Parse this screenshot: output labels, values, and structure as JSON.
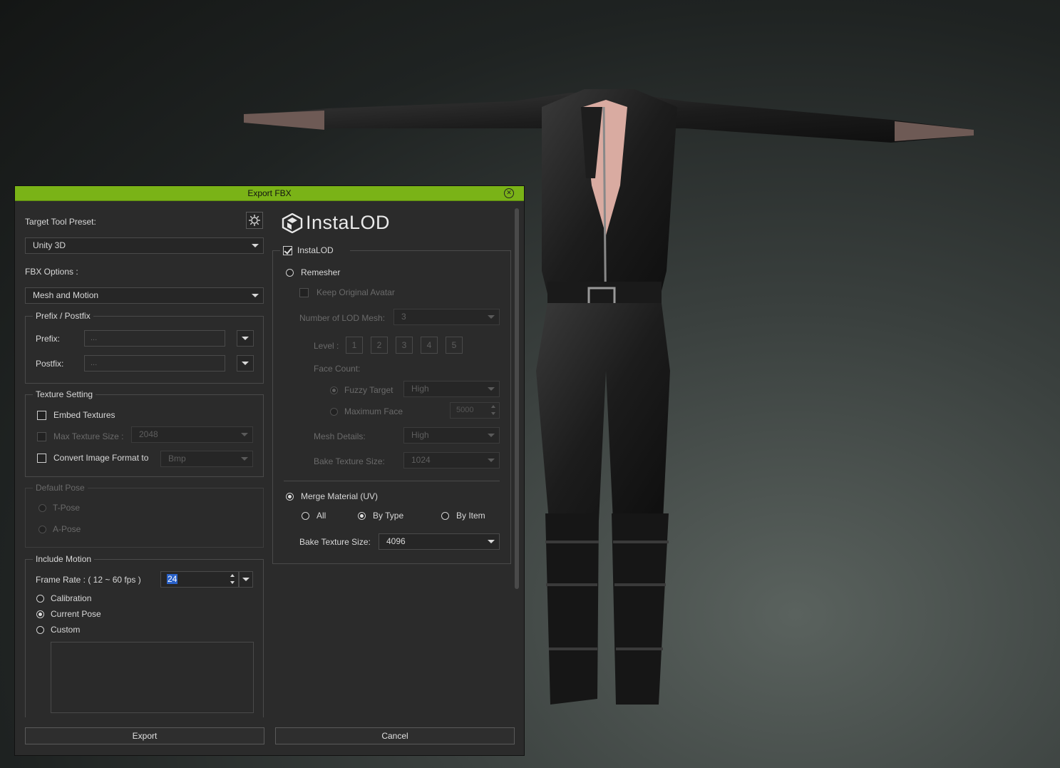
{
  "dialog": {
    "title": "Export FBX",
    "close_icon": "close-icon",
    "target_tool_preset_label": "Target Tool Preset:",
    "target_tool_preset_value": "Unity 3D",
    "fbx_options_label": "FBX Options :",
    "fbx_options_value": "Mesh and Motion",
    "prefix_postfix": {
      "legend": "Prefix / Postfix",
      "prefix_label": "Prefix:",
      "prefix_value": "...",
      "postfix_label": "Postfix:",
      "postfix_value": "..."
    },
    "texture_setting": {
      "legend": "Texture Setting",
      "embed_textures_label": "Embed Textures",
      "embed_textures_checked": false,
      "max_texture_size_label": "Max Texture Size :",
      "max_texture_size_value": "2048",
      "convert_format_label": "Convert Image Format to",
      "convert_format_value": "Bmp"
    },
    "default_pose": {
      "legend": "Default Pose",
      "t_pose": "T-Pose",
      "a_pose": "A-Pose"
    },
    "include_motion": {
      "legend": "Include Motion",
      "frame_rate_label": "Frame Rate : ( 12 ~ 60 fps )",
      "frame_rate_value": "24",
      "calibration": "Calibration",
      "current_pose": "Current Pose",
      "custom": "Custom",
      "selected": "Current Pose"
    },
    "export_button": "Export",
    "cancel_button": "Cancel"
  },
  "instalod": {
    "logo_text": "InstaLOD",
    "enable_label": "InstaLOD",
    "enable_checked": true,
    "remesher_label": "Remesher",
    "keep_original_avatar_label": "Keep Original Avatar",
    "lod_mesh_label": "Number of LOD Mesh:",
    "lod_mesh_value": "3",
    "level_label": "Level :",
    "levels": [
      "1",
      "2",
      "3",
      "4",
      "5"
    ],
    "face_count_label": "Face Count:",
    "fuzzy_target_label": "Fuzzy Target",
    "fuzzy_target_value": "High",
    "maximum_face_label": "Maximum Face",
    "maximum_face_value": "5000",
    "mesh_details_label": "Mesh Details:",
    "mesh_details_value": "High",
    "bake_texture_size_disabled_label": "Bake Texture Size:",
    "bake_texture_size_disabled_value": "1024",
    "merge_material_label": "Merge Material (UV)",
    "merge_all": "All",
    "merge_by_type": "By Type",
    "merge_by_item": "By Item",
    "merge_selected": "By Type",
    "bake_texture_size_label": "Bake Texture Size:",
    "bake_texture_size_value": "4096"
  },
  "colors": {
    "title_bar": "#7ab317",
    "dialog_bg": "#2b2b2b",
    "selection": "#2a62c9"
  }
}
